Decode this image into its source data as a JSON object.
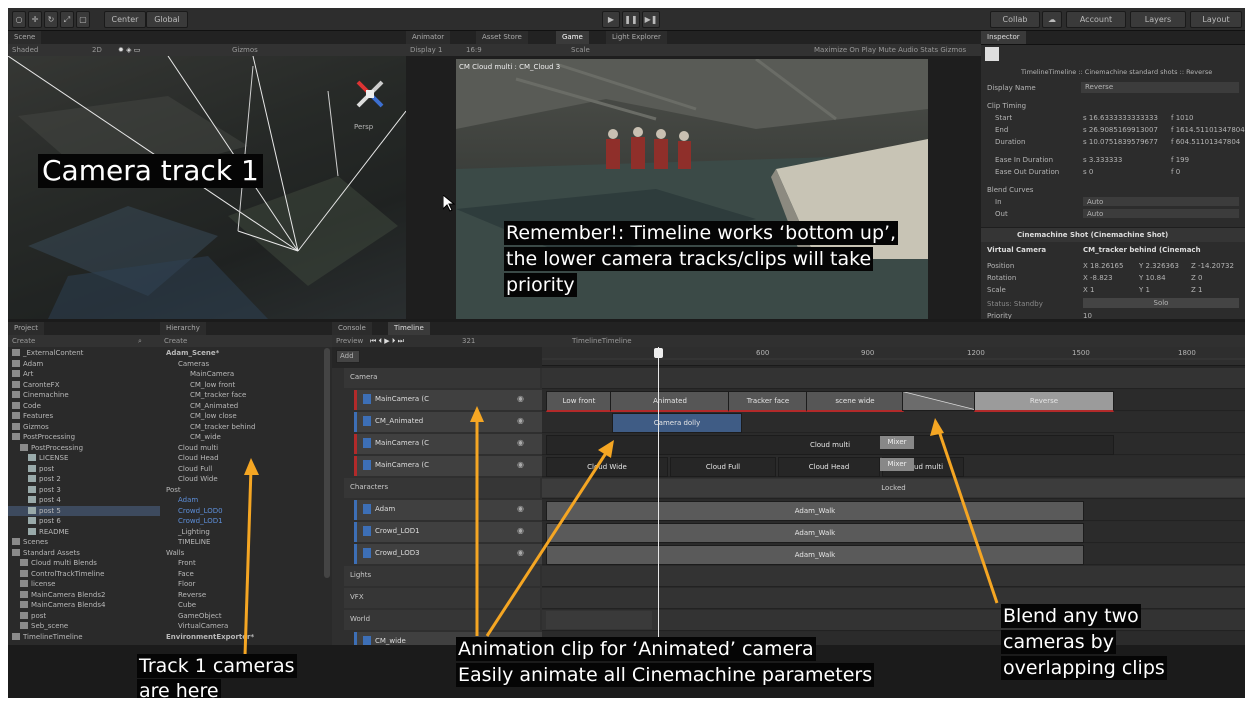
{
  "toolbar": {
    "pivot": "Center",
    "space": "Global",
    "collab": "Collab",
    "account": "Account",
    "layers": "Layers",
    "layout": "Layout"
  },
  "scene": {
    "tab": "Scene",
    "shading": "Shaded",
    "mode": "2D",
    "gizmos": "Gizmos",
    "persp": "Persp"
  },
  "game": {
    "tabs": [
      "Animator",
      "Asset Store",
      "Game",
      "Light Explorer"
    ],
    "display": "Display 1",
    "aspect": "16:9",
    "scale": "Scale",
    "options": "Maximize On Play  Mute Audio  Stats  Gizmos",
    "overlay": "CM Cloud multi : CM_Cloud 3"
  },
  "inspector": {
    "tab": "Inspector",
    "title": "TimelineTimeline :: Cinemachine standard shots :: Reverse",
    "display_name_label": "Display Name",
    "display_name": "Reverse",
    "clip_timing": "Clip Timing",
    "rows": [
      {
        "label": "Start",
        "s": "s 16.6333333333333",
        "f": "f 1010"
      },
      {
        "label": "End",
        "s": "s 26.9085169913007",
        "f": "f 1614.51101347804"
      },
      {
        "label": "Duration",
        "s": "s 10.0751839579677",
        "f": "f 604.51101347804"
      },
      {
        "label": "Ease In Duration",
        "s": "s 3.333333",
        "f": "f 199"
      },
      {
        "label": "Ease Out Duration",
        "s": "s 0",
        "f": "f 0"
      }
    ],
    "blend_curves": "Blend Curves",
    "in_label": "In",
    "out_label": "Out",
    "auto": "Auto",
    "shot_header": "Cinemachine Shot (Cinemachine Shot)",
    "vcam_label": "Virtual Camera",
    "vcam_value": "CM_tracker behind (Cinemach",
    "position_label": "Position",
    "position": [
      "X 18.26165",
      "Y 2.326363",
      "Z -14.20732"
    ],
    "rotation_label": "Rotation",
    "rotation": [
      "X -8.823",
      "Y 10.84",
      "Z 0"
    ],
    "scale_label": "Scale",
    "scale": [
      "X 1",
      "Y 1",
      "Z 1"
    ],
    "status_label": "Status: Standby",
    "solo": "Solo",
    "priority_label": "Priority",
    "priority": "10"
  },
  "project": {
    "tab": "Project",
    "create": "Create",
    "items": [
      "_ExternalContent",
      "Adam",
      "Art",
      "CaronteFX",
      "Cinemachine",
      "Code",
      "Features",
      "Gizmos",
      "PostProcessing",
      "PostProcessing",
      "LICENSE",
      "post",
      "post 2",
      "post 3",
      "post 4",
      "post 5",
      "post 6",
      "README",
      "Scenes",
      "Standard Assets",
      "Cloud multi Blends",
      "ControlTrackTimeline",
      "license",
      "MainCamera Blends2",
      "MainCamera Blends4",
      "post",
      "Seb_scene",
      "TimelineTimeline"
    ]
  },
  "hierarchy": {
    "tab": "Hierarchy",
    "create": "Create",
    "items": [
      "Adam_Scene*",
      "Cameras",
      "MainCamera",
      "CM_low front",
      "CM_tracker face",
      "CM_Animated",
      "CM_low close",
      "CM_tracker behind",
      "CM_wide",
      "Cloud multi",
      "Cloud Head",
      "Cloud Full",
      "Cloud Wide",
      "Post",
      "Adam",
      "Crowd_LOD0",
      "Crowd_LOD1",
      "_Lighting",
      "TIMELINE",
      "Walls",
      "Front",
      "Face",
      "Floor",
      "Reverse",
      "Cube",
      "GameObject",
      "VirtualCamera",
      "EnvironmentExporter*"
    ]
  },
  "timeline": {
    "tabs": [
      "Console",
      "Timeline"
    ],
    "preview": "Preview",
    "frame": "321",
    "asset": "TimelineTimeline",
    "add": "Add",
    "ruler": [
      "600",
      "900",
      "1200",
      "1500",
      "1800"
    ],
    "groups": [
      "Camera",
      "Characters",
      "Lights",
      "VFX",
      "World"
    ],
    "tracks": [
      "MainCamera (C",
      "CM_Animated",
      "MainCamera (C",
      "MainCamera (C",
      "Adam",
      "Crowd_LOD1",
      "Crowd_LOD3",
      "CM_wide"
    ],
    "cam_clips": [
      "Low front",
      "Animated",
      "Tracker face",
      "scene wide",
      "",
      "Reverse"
    ],
    "anim_clip": "Camera dolly",
    "cloud1": "Cloud multi",
    "cloud2": [
      "Cloud Wide",
      "Cloud Full",
      "Cloud Head",
      "Cloud multi"
    ],
    "mixer": "Mixer",
    "locked": "Locked",
    "walk": "Adam_Walk"
  },
  "annotations": {
    "camera_track": "Camera track 1",
    "remember": [
      "Remember!: Timeline works ‘bottom up’,",
      "the lower camera tracks/clips will take",
      "priority"
    ],
    "track_cams": [
      "Track 1 cameras",
      "are here"
    ],
    "anim_clip": [
      "Animation clip for ‘Animated’ camera",
      "Easily animate all Cinemachine parameters"
    ],
    "blend": [
      "Blend any two",
      "cameras by",
      "overlapping clips"
    ]
  },
  "colors": {
    "arrow": "#f5a623",
    "accent_blue": "#3d6fb6",
    "clip_red": "#b22a2a"
  }
}
